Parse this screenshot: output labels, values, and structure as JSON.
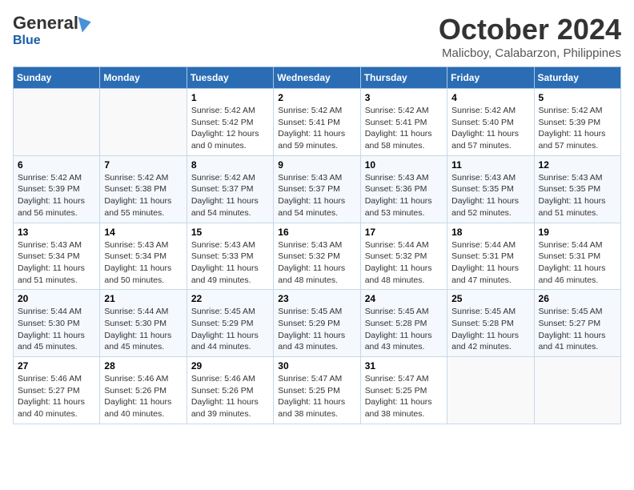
{
  "header": {
    "logo_general": "General",
    "logo_blue": "Blue",
    "month": "October 2024",
    "location": "Malicboy, Calabarzon, Philippines"
  },
  "columns": [
    "Sunday",
    "Monday",
    "Tuesday",
    "Wednesday",
    "Thursday",
    "Friday",
    "Saturday"
  ],
  "weeks": [
    [
      {
        "day": "",
        "text": ""
      },
      {
        "day": "",
        "text": ""
      },
      {
        "day": "1",
        "text": "Sunrise: 5:42 AM\nSunset: 5:42 PM\nDaylight: 12 hours\nand 0 minutes."
      },
      {
        "day": "2",
        "text": "Sunrise: 5:42 AM\nSunset: 5:41 PM\nDaylight: 11 hours\nand 59 minutes."
      },
      {
        "day": "3",
        "text": "Sunrise: 5:42 AM\nSunset: 5:41 PM\nDaylight: 11 hours\nand 58 minutes."
      },
      {
        "day": "4",
        "text": "Sunrise: 5:42 AM\nSunset: 5:40 PM\nDaylight: 11 hours\nand 57 minutes."
      },
      {
        "day": "5",
        "text": "Sunrise: 5:42 AM\nSunset: 5:39 PM\nDaylight: 11 hours\nand 57 minutes."
      }
    ],
    [
      {
        "day": "6",
        "text": "Sunrise: 5:42 AM\nSunset: 5:39 PM\nDaylight: 11 hours\nand 56 minutes."
      },
      {
        "day": "7",
        "text": "Sunrise: 5:42 AM\nSunset: 5:38 PM\nDaylight: 11 hours\nand 55 minutes."
      },
      {
        "day": "8",
        "text": "Sunrise: 5:42 AM\nSunset: 5:37 PM\nDaylight: 11 hours\nand 54 minutes."
      },
      {
        "day": "9",
        "text": "Sunrise: 5:43 AM\nSunset: 5:37 PM\nDaylight: 11 hours\nand 54 minutes."
      },
      {
        "day": "10",
        "text": "Sunrise: 5:43 AM\nSunset: 5:36 PM\nDaylight: 11 hours\nand 53 minutes."
      },
      {
        "day": "11",
        "text": "Sunrise: 5:43 AM\nSunset: 5:35 PM\nDaylight: 11 hours\nand 52 minutes."
      },
      {
        "day": "12",
        "text": "Sunrise: 5:43 AM\nSunset: 5:35 PM\nDaylight: 11 hours\nand 51 minutes."
      }
    ],
    [
      {
        "day": "13",
        "text": "Sunrise: 5:43 AM\nSunset: 5:34 PM\nDaylight: 11 hours\nand 51 minutes."
      },
      {
        "day": "14",
        "text": "Sunrise: 5:43 AM\nSunset: 5:34 PM\nDaylight: 11 hours\nand 50 minutes."
      },
      {
        "day": "15",
        "text": "Sunrise: 5:43 AM\nSunset: 5:33 PM\nDaylight: 11 hours\nand 49 minutes."
      },
      {
        "day": "16",
        "text": "Sunrise: 5:43 AM\nSunset: 5:32 PM\nDaylight: 11 hours\nand 48 minutes."
      },
      {
        "day": "17",
        "text": "Sunrise: 5:44 AM\nSunset: 5:32 PM\nDaylight: 11 hours\nand 48 minutes."
      },
      {
        "day": "18",
        "text": "Sunrise: 5:44 AM\nSunset: 5:31 PM\nDaylight: 11 hours\nand 47 minutes."
      },
      {
        "day": "19",
        "text": "Sunrise: 5:44 AM\nSunset: 5:31 PM\nDaylight: 11 hours\nand 46 minutes."
      }
    ],
    [
      {
        "day": "20",
        "text": "Sunrise: 5:44 AM\nSunset: 5:30 PM\nDaylight: 11 hours\nand 45 minutes."
      },
      {
        "day": "21",
        "text": "Sunrise: 5:44 AM\nSunset: 5:30 PM\nDaylight: 11 hours\nand 45 minutes."
      },
      {
        "day": "22",
        "text": "Sunrise: 5:45 AM\nSunset: 5:29 PM\nDaylight: 11 hours\nand 44 minutes."
      },
      {
        "day": "23",
        "text": "Sunrise: 5:45 AM\nSunset: 5:29 PM\nDaylight: 11 hours\nand 43 minutes."
      },
      {
        "day": "24",
        "text": "Sunrise: 5:45 AM\nSunset: 5:28 PM\nDaylight: 11 hours\nand 43 minutes."
      },
      {
        "day": "25",
        "text": "Sunrise: 5:45 AM\nSunset: 5:28 PM\nDaylight: 11 hours\nand 42 minutes."
      },
      {
        "day": "26",
        "text": "Sunrise: 5:45 AM\nSunset: 5:27 PM\nDaylight: 11 hours\nand 41 minutes."
      }
    ],
    [
      {
        "day": "27",
        "text": "Sunrise: 5:46 AM\nSunset: 5:27 PM\nDaylight: 11 hours\nand 40 minutes."
      },
      {
        "day": "28",
        "text": "Sunrise: 5:46 AM\nSunset: 5:26 PM\nDaylight: 11 hours\nand 40 minutes."
      },
      {
        "day": "29",
        "text": "Sunrise: 5:46 AM\nSunset: 5:26 PM\nDaylight: 11 hours\nand 39 minutes."
      },
      {
        "day": "30",
        "text": "Sunrise: 5:47 AM\nSunset: 5:25 PM\nDaylight: 11 hours\nand 38 minutes."
      },
      {
        "day": "31",
        "text": "Sunrise: 5:47 AM\nSunset: 5:25 PM\nDaylight: 11 hours\nand 38 minutes."
      },
      {
        "day": "",
        "text": ""
      },
      {
        "day": "",
        "text": ""
      }
    ]
  ]
}
